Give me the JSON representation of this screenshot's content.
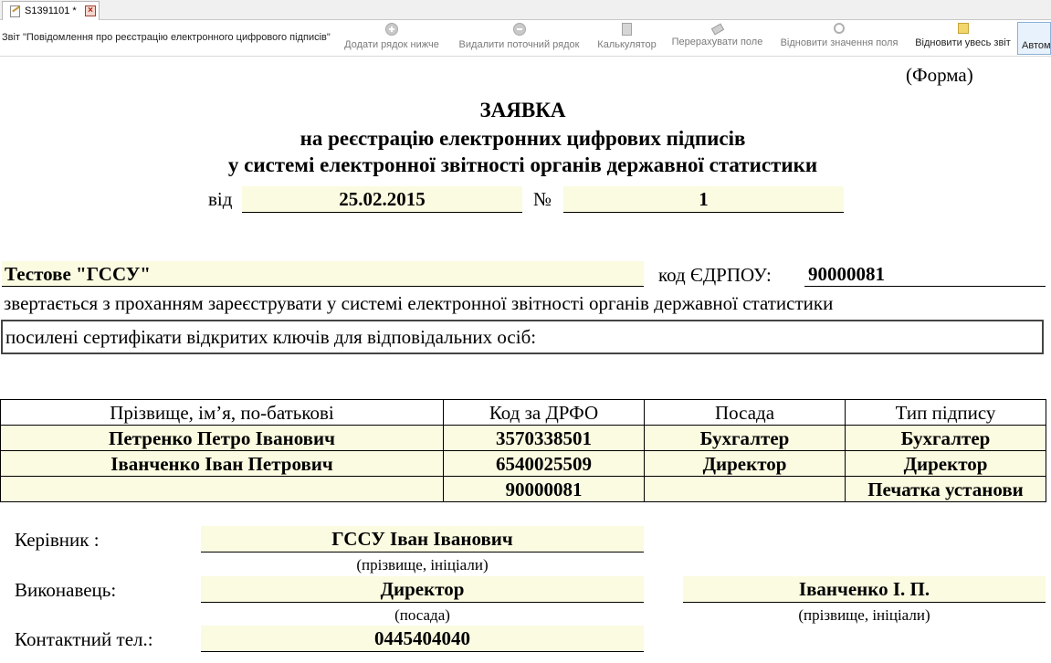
{
  "tab": {
    "title": "S1391101 *",
    "close_symbol": "×"
  },
  "toolbar": {
    "report_title": "Звіт \"Повідомлення про реєстрацію електронного цифрового підписів\"",
    "buttons": [
      {
        "label": "Додати рядок нижче",
        "icon": "add-row-icon"
      },
      {
        "label": "Видалити поточний рядок",
        "icon": "delete-row-icon"
      },
      {
        "label": "Калькулятор",
        "icon": "calculator-icon"
      },
      {
        "label": "Перерахувати поле",
        "icon": "recalculate-icon"
      },
      {
        "label": "Відновити значення поля",
        "icon": "restore-field-icon"
      },
      {
        "label": "Відновити увесь звіт",
        "icon": "restore-report-icon"
      }
    ],
    "auto_label": "Автом"
  },
  "form": {
    "forma_label": "(Форма)",
    "title": "ЗАЯВКА",
    "subtitle1": "на реєстрацію електронних цифрових підписів",
    "subtitle2": "у системі електронної звітності органів державної статистики",
    "date_label": "від",
    "date_value": "25.02.2015",
    "number_label": "№",
    "number_value": "1",
    "org_name": "Тестове \"ГССУ\"",
    "edrpou_label": "код ЄДРПОУ:",
    "edrpou_value": "90000081",
    "request_text": "звертається з проханням зареєструвати у системі електронної звітності органів державної статистики",
    "certs_text": "посилені сертифікати відкритих ключів для відповідальних осіб:"
  },
  "signers_table": {
    "headers": [
      "Прізвище, ім’я, по-батькові",
      "Код за ДРФО",
      "Посада",
      "Тип підпису"
    ],
    "rows": [
      [
        "Петренко Петро Іванович",
        "3570338501",
        "Бухгалтер",
        "Бухгалтер"
      ],
      [
        "Іванченко Іван Петрович",
        "6540025509",
        "Директор",
        "Директор"
      ],
      [
        "",
        "90000081",
        "",
        "Печатка установи"
      ]
    ]
  },
  "footer": {
    "head_label": "Керівник :",
    "head_name": "ГССУ Іван Іванович",
    "head_caption": "(прізвище, ініціали)",
    "executor_label": "Виконавець:",
    "executor_position": "Директор",
    "position_caption": "(посада)",
    "executor_name": "Іванченко І. П.",
    "executor_name_caption": "(прізвище, ініціали)",
    "phone_label": "Контактний тел.:",
    "phone_value": "0445404040"
  }
}
